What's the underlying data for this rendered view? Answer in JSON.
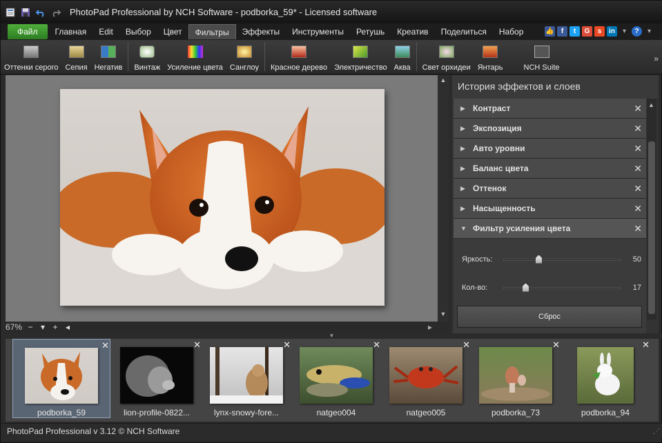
{
  "window": {
    "title": "PhotoPad Professional by NCH Software - podborka_59* - Licensed software",
    "controls": [
      "–",
      "□",
      "✕"
    ]
  },
  "menu": {
    "items": [
      "Файл",
      "Главная",
      "Edit",
      "Выбор",
      "Цвет",
      "Фильтры",
      "Эффекты",
      "Инструменты",
      "Ретушь",
      "Креатив",
      "Поделиться",
      "Набор"
    ],
    "active": "Фильтры"
  },
  "toolbar": {
    "buttons": [
      "Оттенки серого",
      "Сепия",
      "Негатив",
      "Винтаж",
      "Усиление цвета",
      "Санглоу",
      "Красное дерево",
      "Электричество",
      "Аква",
      "Свет орхидеи",
      "Янтарь",
      "NCH Suite"
    ],
    "more": "»"
  },
  "canvas": {
    "zoom": "67%"
  },
  "panel": {
    "title": "История эффектов и слоев",
    "effects": [
      "Контраст",
      "Экспозиция",
      "Авто уровни",
      "Баланс цвета",
      "Оттенок",
      "Насыщенность"
    ],
    "expanded": {
      "name": "Фильтр усиления цвета",
      "sliders": [
        {
          "label": "Яркость:",
          "value": "50",
          "fraction": 0.29
        },
        {
          "label": "Кол-во:",
          "value": "17",
          "fraction": 0.17
        }
      ],
      "reset_label": "Сброс"
    }
  },
  "thumbnails": [
    {
      "name": "podborka_59",
      "selected": true
    },
    {
      "name": "lion-profile-0822...",
      "selected": false
    },
    {
      "name": "lynx-snowy-fore...",
      "selected": false
    },
    {
      "name": "natgeo004",
      "selected": false
    },
    {
      "name": "natgeo005",
      "selected": false
    },
    {
      "name": "podborka_73",
      "selected": false
    },
    {
      "name": "podborka_94",
      "selected": false
    }
  ],
  "status": {
    "text": "PhotoPad Professional v 3.12 © NCH Software"
  },
  "colors": {
    "file_menu": "#3d9a2e",
    "accent_selected": "#5a6573"
  }
}
